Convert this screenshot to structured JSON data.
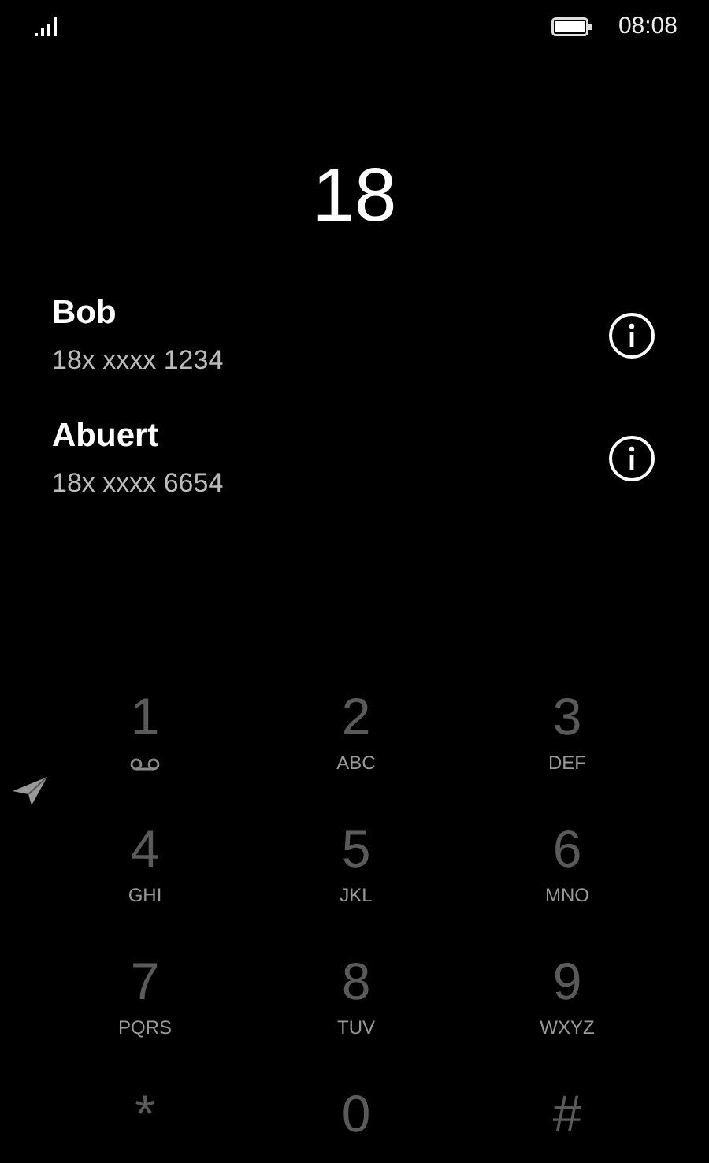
{
  "status_bar": {
    "time": "08:08"
  },
  "dialed_number": "18",
  "contacts": [
    {
      "name": "Bob",
      "number": "18x xxxx 1234"
    },
    {
      "name": "Abuert",
      "number": "18x xxxx 6654"
    }
  ],
  "keypad": [
    {
      "digit": "1",
      "kind": "voicemail"
    },
    {
      "digit": "2",
      "letters": "ABC",
      "kind": "letters"
    },
    {
      "digit": "3",
      "letters": "DEF",
      "kind": "letters"
    },
    {
      "digit": "4",
      "letters": "GHI",
      "kind": "letters"
    },
    {
      "digit": "5",
      "letters": "JKL",
      "kind": "letters"
    },
    {
      "digit": "6",
      "letters": "MNO",
      "kind": "letters"
    },
    {
      "digit": "7",
      "letters": "PQRS",
      "kind": "letters"
    },
    {
      "digit": "8",
      "letters": "TUV",
      "kind": "letters"
    },
    {
      "digit": "9",
      "letters": "WXYZ",
      "kind": "letters"
    },
    {
      "digit": "*",
      "kind": "plain"
    },
    {
      "digit": "0",
      "kind": "plain"
    },
    {
      "digit": "#",
      "kind": "plain"
    }
  ]
}
